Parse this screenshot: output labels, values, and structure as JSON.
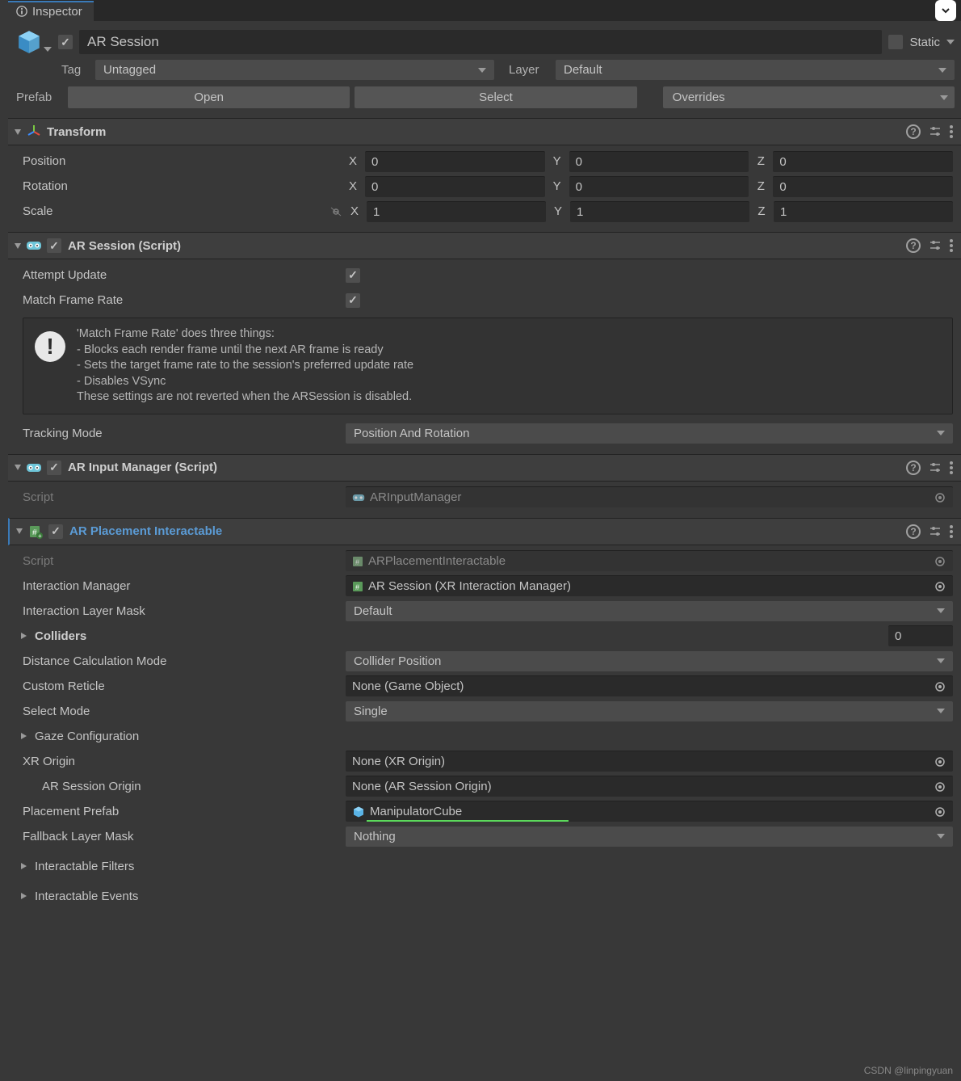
{
  "tab": {
    "label": "Inspector"
  },
  "header": {
    "name": "AR Session",
    "static_label": "Static",
    "tag_label": "Tag",
    "tag_value": "Untagged",
    "layer_label": "Layer",
    "layer_value": "Default",
    "prefab_label": "Prefab",
    "open_btn": "Open",
    "select_btn": "Select",
    "overrides_btn": "Overrides"
  },
  "transform": {
    "title": "Transform",
    "position_label": "Position",
    "rotation_label": "Rotation",
    "scale_label": "Scale",
    "x": "X",
    "y": "Y",
    "z": "Z",
    "position": {
      "x": "0",
      "y": "0",
      "z": "0"
    },
    "rotation": {
      "x": "0",
      "y": "0",
      "z": "0"
    },
    "scale": {
      "x": "1",
      "y": "1",
      "z": "1"
    }
  },
  "ar_session": {
    "title": "AR Session (Script)",
    "attempt_update_label": "Attempt Update",
    "match_frame_rate_label": "Match Frame Rate",
    "info_lines": [
      "'Match Frame Rate' does three things:",
      "- Blocks each render frame until the next AR frame is ready",
      "- Sets the target frame rate to the session's preferred update rate",
      "- Disables VSync",
      "These settings are not reverted when the ARSession is disabled."
    ],
    "tracking_mode_label": "Tracking Mode",
    "tracking_mode_value": "Position And Rotation"
  },
  "ar_input": {
    "title": "AR Input Manager (Script)",
    "script_label": "Script",
    "script_value": "ARInputManager"
  },
  "ar_placement": {
    "title": "AR Placement Interactable",
    "script_label": "Script",
    "script_value": "ARPlacementInteractable",
    "interaction_manager_label": "Interaction Manager",
    "interaction_manager_value": "AR Session (XR Interaction Manager)",
    "interaction_layer_mask_label": "Interaction Layer Mask",
    "interaction_layer_mask_value": "Default",
    "colliders_label": "Colliders",
    "colliders_count": "0",
    "distance_calc_label": "Distance Calculation Mode",
    "distance_calc_value": "Collider Position",
    "custom_reticle_label": "Custom Reticle",
    "custom_reticle_value": "None (Game Object)",
    "select_mode_label": "Select Mode",
    "select_mode_value": "Single",
    "gaze_config_label": "Gaze Configuration",
    "xr_origin_label": "XR Origin",
    "xr_origin_value": "None (XR Origin)",
    "ar_session_origin_label": "AR Session Origin",
    "ar_session_origin_value": "None (AR Session Origin)",
    "placement_prefab_label": "Placement Prefab",
    "placement_prefab_value": "ManipulatorCube",
    "fallback_layer_mask_label": "Fallback Layer Mask",
    "fallback_layer_mask_value": "Nothing",
    "interactable_filters_label": "Interactable Filters",
    "interactable_events_label": "Interactable Events"
  },
  "watermark": "CSDN @linpingyuan"
}
